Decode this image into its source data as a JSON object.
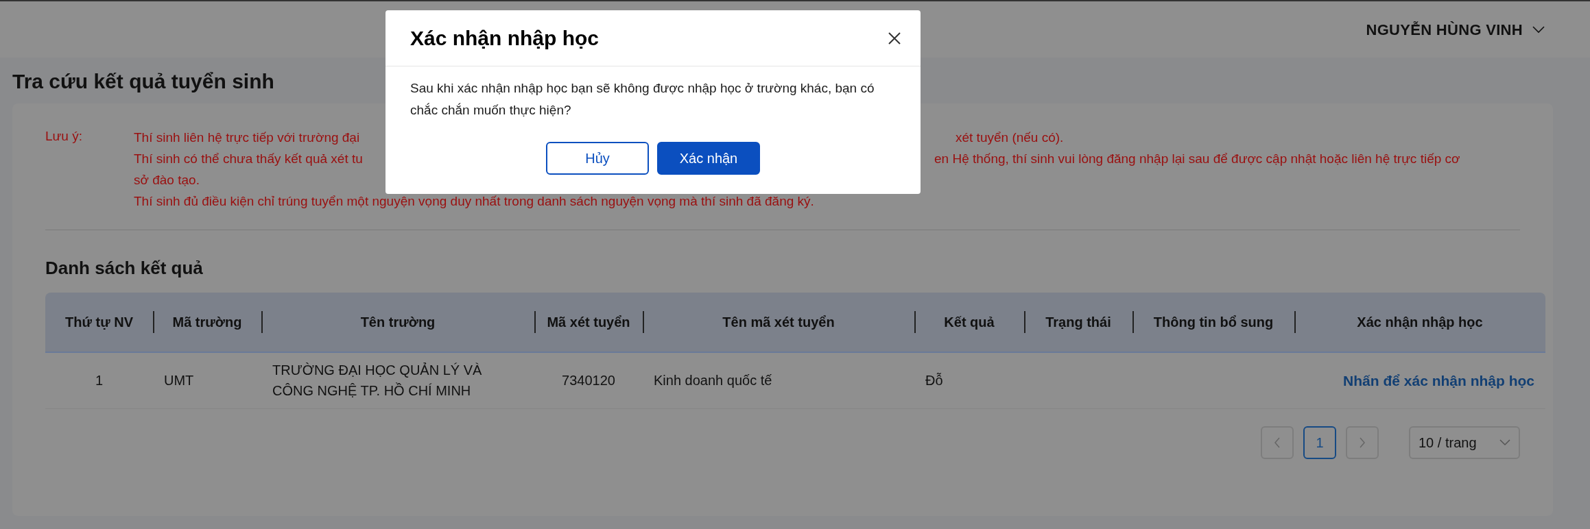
{
  "header": {
    "user_name": "NGUYỄN HÙNG VINH"
  },
  "page_title": "Tra cứu kết quả tuyển sinh",
  "notes": {
    "label": "Lưu ý:",
    "lines": [
      {
        "left": "Thí sinh liên hệ trực tiếp với trường đại",
        "right": "xét tuyển (nếu có)."
      },
      {
        "left": "Thí sinh có thể chưa thấy kết quả xét tu",
        "right": "en Hệ thống, thí sinh vui lòng đăng nhập lại sau để được cập nhật hoặc liên hệ trực tiếp cơ"
      },
      {
        "left": "sở đào tạo."
      },
      {
        "left": "Thí sinh đủ điều kiện chỉ trúng tuyển một nguyện vọng duy nhất trong danh sách nguyện vọng mà thí sinh đã đăng ký."
      }
    ]
  },
  "results": {
    "title": "Danh sách kết quả",
    "columns": [
      "Thứ tự NV",
      "Mã trường",
      "Tên trường",
      "Mã xét tuyển",
      "Tên mã xét tuyển",
      "Kết quả",
      "Trạng thái",
      "Thông tin bổ sung",
      "Xác nhận nhập học"
    ],
    "rows": [
      {
        "cells": [
          "1",
          "UMT",
          "TRƯỜNG ĐẠI HỌC QUẢN LÝ VÀ CÔNG NGHỆ TP. HỒ CHÍ MINH",
          "7340120",
          "Kinh doanh quốc tế",
          "Đỗ",
          "",
          ""
        ],
        "action": "Nhấn để xác nhận nhập học"
      }
    ]
  },
  "pagination": {
    "prev_disabled": true,
    "next_disabled": true,
    "pages": [
      {
        "label": "1",
        "selected": true
      }
    ],
    "page_size": "10 / trang"
  },
  "modal": {
    "title": "Xác nhận nhập học",
    "message": "Sau khi xác nhận nhập học bạn sẽ không được nhập học ở trường khác, bạn có chắc chắn muốn thực hiện?",
    "buttons": [
      {
        "label": "Hủy",
        "kind": "secondary"
      },
      {
        "label": "Xác nhận",
        "kind": "primary"
      }
    ]
  }
}
